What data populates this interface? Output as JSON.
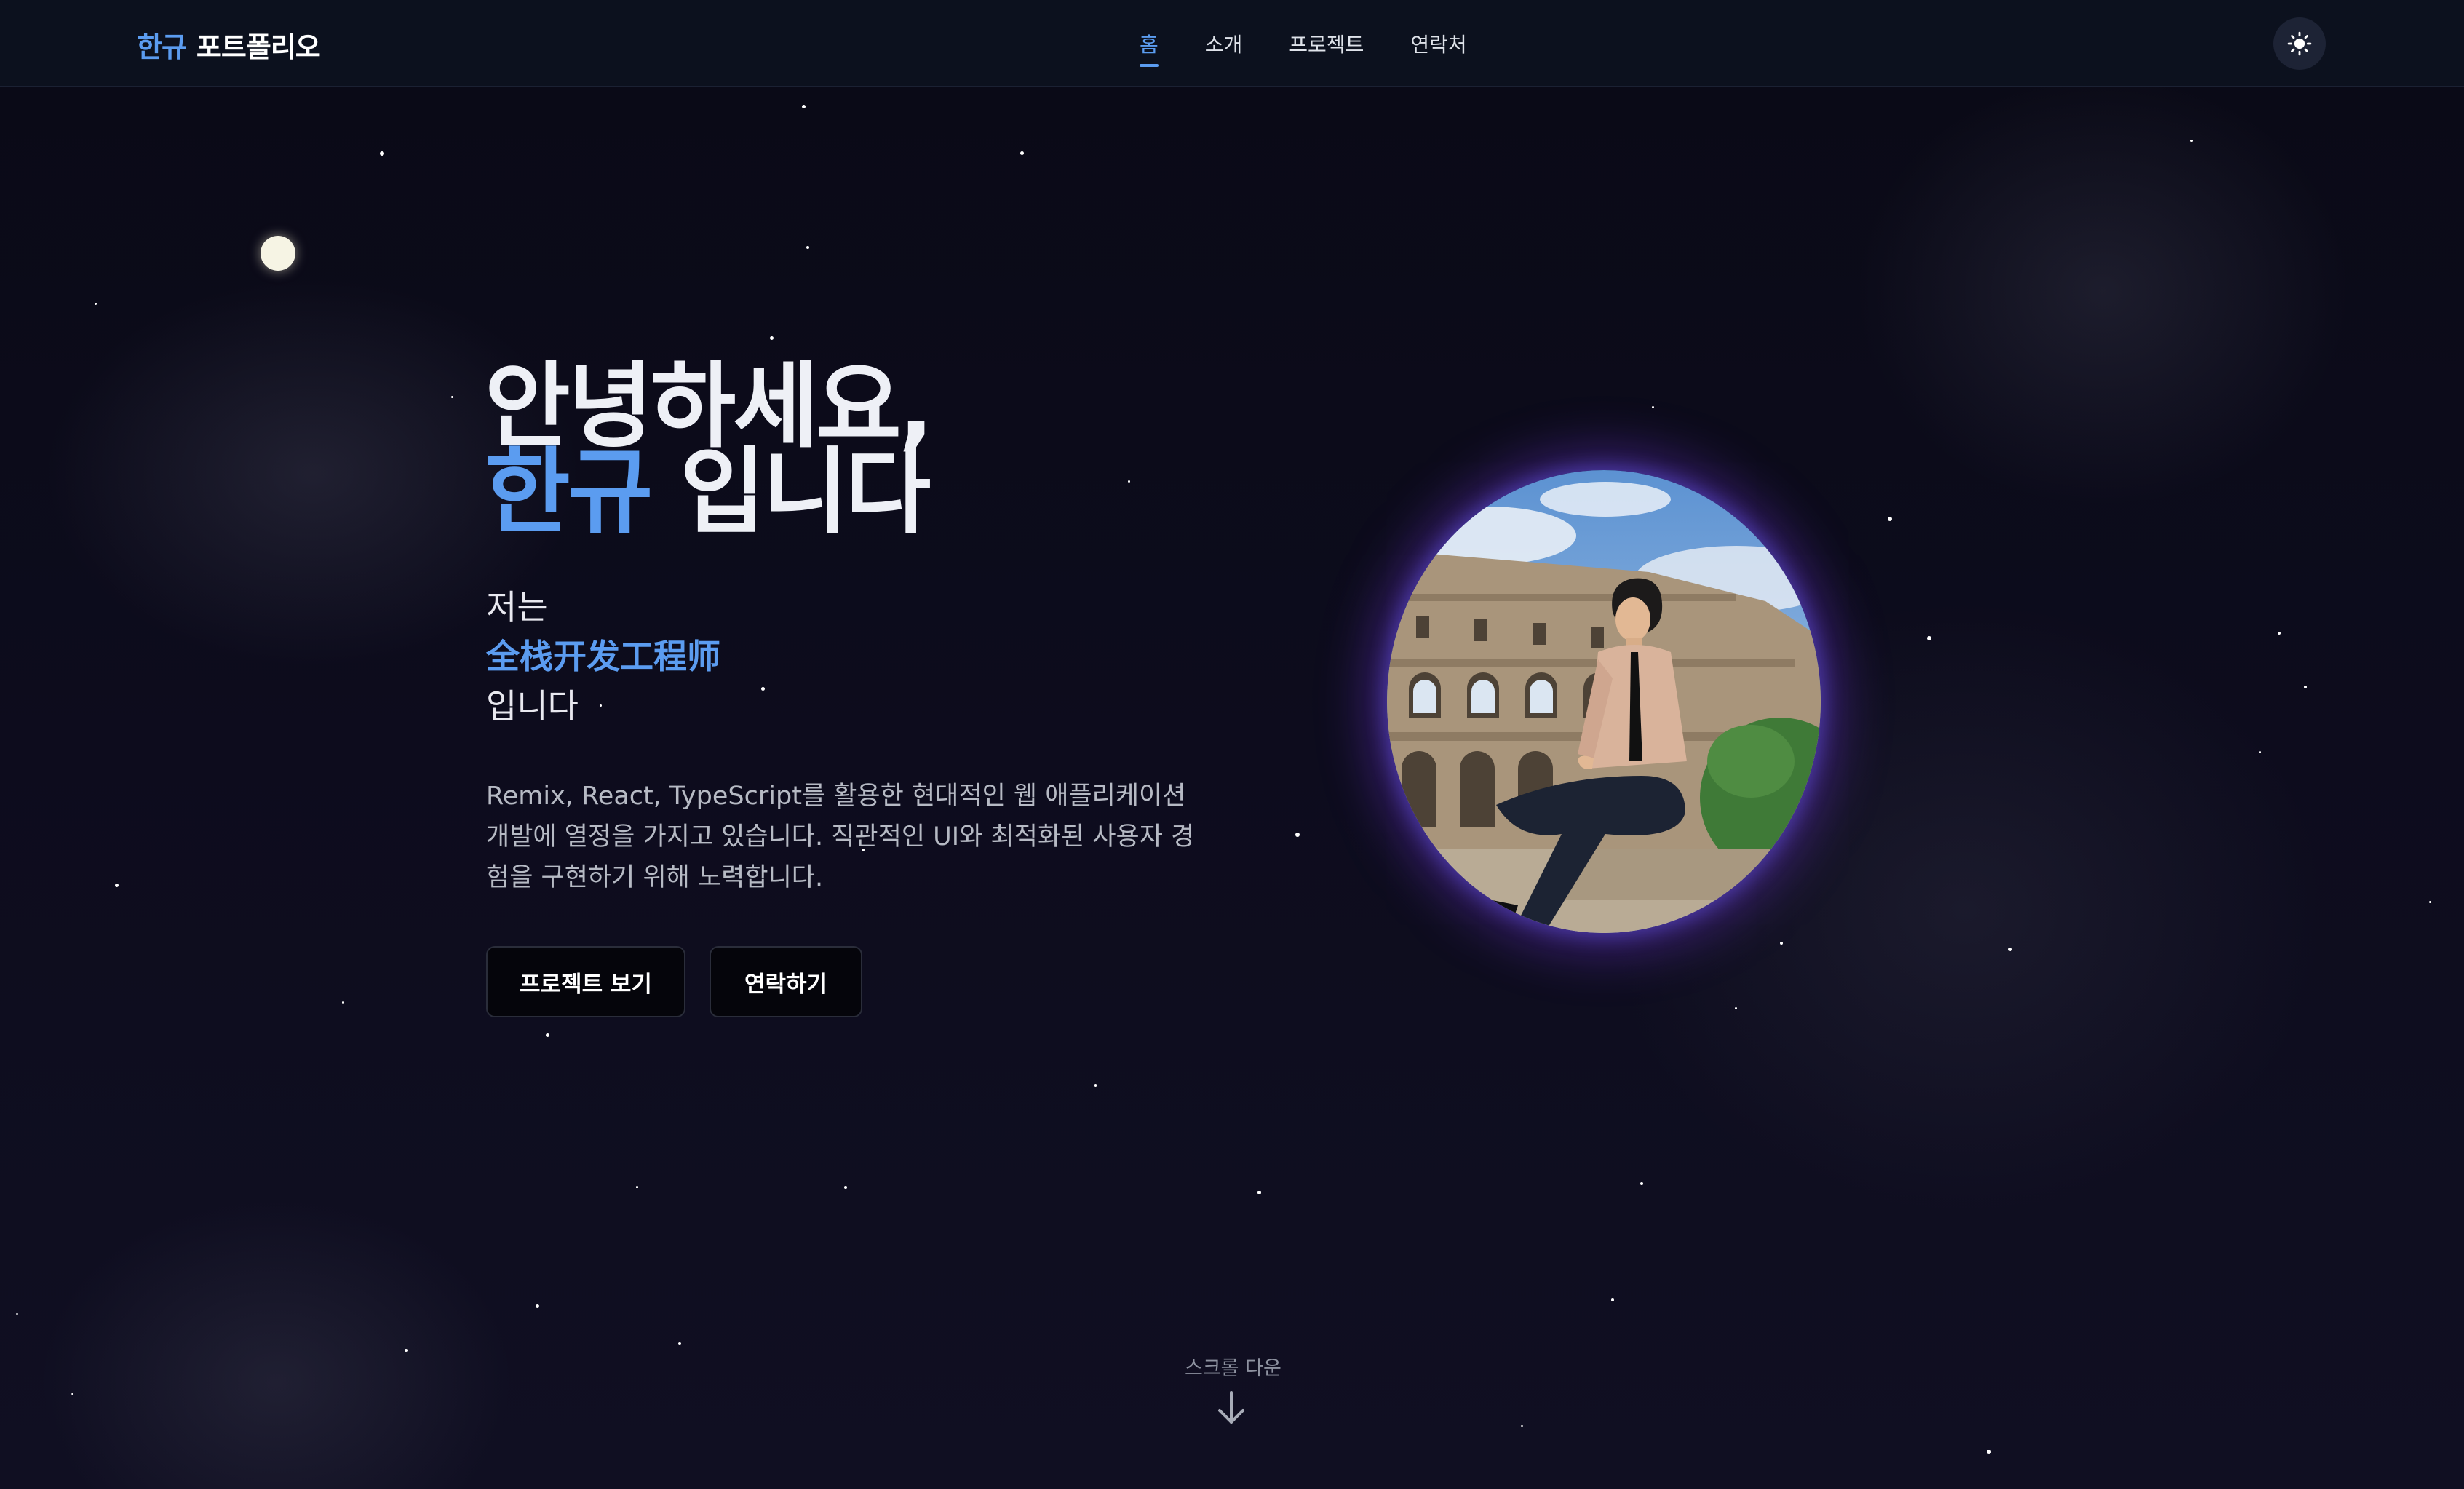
{
  "nav": {
    "logo_accent": "한규",
    "logo_rest": "포트폴리오",
    "links": [
      "홈",
      "소개",
      "프로젝트",
      "연락처"
    ],
    "active_link": "홈",
    "theme_icon": "sun-icon"
  },
  "hero": {
    "greeting": "안녕하세요,",
    "name": "한규",
    "name_suffix": "입니다",
    "intro_line1": "저는",
    "role": "全栈开发工程师",
    "intro_line3": "입니다",
    "description": "Remix, React, TypeScript를 활용한 현대적인 웹 애플리케이션 개발에 열정을 가지고 있습니다. 직관적인 UI와 최적화된 사용자 경험을 구현하기 위해 노력합니다.",
    "buttons": {
      "projects": "프로젝트 보기",
      "contact": "연락하기"
    }
  },
  "scroll": {
    "label": "스크롤 다운",
    "icon": "arrow-down-icon"
  },
  "colors": {
    "accent": "#5b9cf0",
    "background": "#0b0b18",
    "avatar_glow": "#7337dc"
  }
}
